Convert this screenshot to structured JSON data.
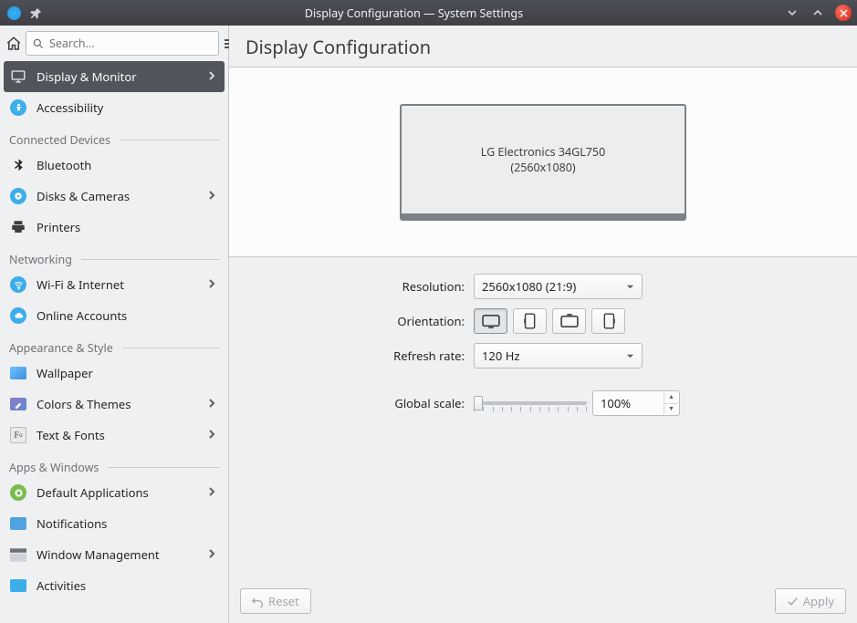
{
  "window": {
    "title": "Display Configuration — System Settings"
  },
  "search": {
    "placeholder": "Search..."
  },
  "sidebar": {
    "items": [
      {
        "label": "Display & Monitor",
        "active": true,
        "chevron": true
      },
      {
        "label": "Accessibility",
        "chevron": false
      }
    ],
    "groups": [
      {
        "heading": "Connected Devices",
        "items": [
          {
            "label": "Bluetooth",
            "chevron": false
          },
          {
            "label": "Disks & Cameras",
            "chevron": true
          },
          {
            "label": "Printers",
            "chevron": false
          }
        ]
      },
      {
        "heading": "Networking",
        "items": [
          {
            "label": "Wi-Fi & Internet",
            "chevron": true
          },
          {
            "label": "Online Accounts",
            "chevron": false
          }
        ]
      },
      {
        "heading": "Appearance & Style",
        "items": [
          {
            "label": "Wallpaper",
            "chevron": false
          },
          {
            "label": "Colors & Themes",
            "chevron": true
          },
          {
            "label": "Text & Fonts",
            "chevron": true
          }
        ]
      },
      {
        "heading": "Apps & Windows",
        "items": [
          {
            "label": "Default Applications",
            "chevron": true
          },
          {
            "label": "Notifications",
            "chevron": false
          },
          {
            "label": "Window Management",
            "chevron": true
          },
          {
            "label": "Activities",
            "chevron": false
          }
        ]
      }
    ]
  },
  "page": {
    "title": "Display Configuration",
    "monitor": {
      "name": "LG Electronics 34GL750",
      "resolution": "(2560x1080)"
    },
    "labels": {
      "resolution": "Resolution:",
      "orientation": "Orientation:",
      "refresh": "Refresh rate:",
      "globalscale": "Global scale:"
    },
    "resolution_value": "2560x1080 (21:9)",
    "refresh_value": "120 Hz",
    "scale_value": "100%",
    "buttons": {
      "reset": "Reset",
      "apply": "Apply"
    }
  }
}
